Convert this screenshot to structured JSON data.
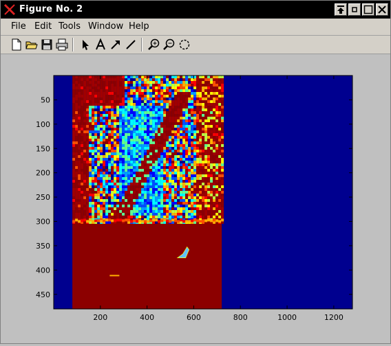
{
  "window": {
    "title": "Figure No. 2"
  },
  "menu": [
    "File",
    "Edit",
    "Tools",
    "Window",
    "Help"
  ],
  "toolbar": {
    "icons": [
      "new-file-icon",
      "open-folder-icon",
      "save-icon",
      "print-icon",
      "pointer-arrow-icon",
      "text-icon",
      "arrow-icon",
      "line-icon",
      "zoom-in-icon",
      "zoom-out-icon",
      "rotate-icon"
    ]
  },
  "colors": {
    "dark_blue": "#00008f",
    "dark_red": "#8c0000",
    "figure_bg": "#c0c0c0"
  },
  "chart_data": {
    "type": "heatmap",
    "colormap": "jet",
    "xlim": [
      0,
      1280
    ],
    "ylim": [
      480,
      0
    ],
    "xticks": [
      200,
      400,
      600,
      800,
      1000,
      1200
    ],
    "yticks": [
      50,
      100,
      150,
      200,
      250,
      300,
      350,
      400,
      450
    ],
    "regions": [
      {
        "label": "background",
        "x": [
          0,
          1280
        ],
        "y": [
          0,
          480
        ],
        "color": "#00008f"
      },
      {
        "label": "upper noisy band",
        "x": [
          80,
          720
        ],
        "y": [
          0,
          300
        ],
        "color": "jet-mixed"
      },
      {
        "label": "lower saturated band",
        "x": [
          80,
          720
        ],
        "y": [
          300,
          480
        ],
        "color": "#8c0000"
      }
    ]
  }
}
